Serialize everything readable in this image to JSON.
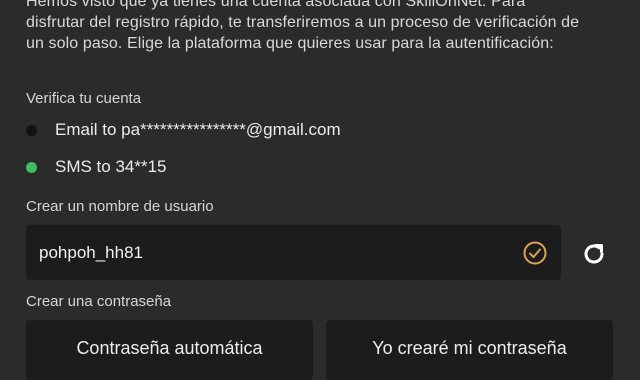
{
  "intro": {
    "line1": "Hemos visto que ya tienes una cuenta asociada con SkillOnNet. Para",
    "line2": "disfrutar del registro rápido, te transferiremos a un proceso de verificación de",
    "line3": "un solo paso. Elige la plataforma que quieres usar para la autentificación:"
  },
  "verify": {
    "label": "Verifica tu cuenta",
    "options": [
      {
        "label": "Email to pa****************@gmail.com",
        "selected": false
      },
      {
        "label": "SMS to 34**15",
        "selected": true
      }
    ]
  },
  "username": {
    "label": "Crear un nombre de usuario",
    "value": "pohpoh_hh81",
    "valid_icon": "check-circle-icon",
    "refresh_icon": "refresh-icon"
  },
  "password": {
    "label": "Crear una contraseña",
    "auto_label": "Contraseña automática",
    "manual_label": "Yo crearé mi contraseña"
  },
  "colors": {
    "background": "#2b2b2b",
    "field": "#1c1c1c",
    "selected_dot": "#3fbf5f",
    "check": "#d9a45a"
  }
}
